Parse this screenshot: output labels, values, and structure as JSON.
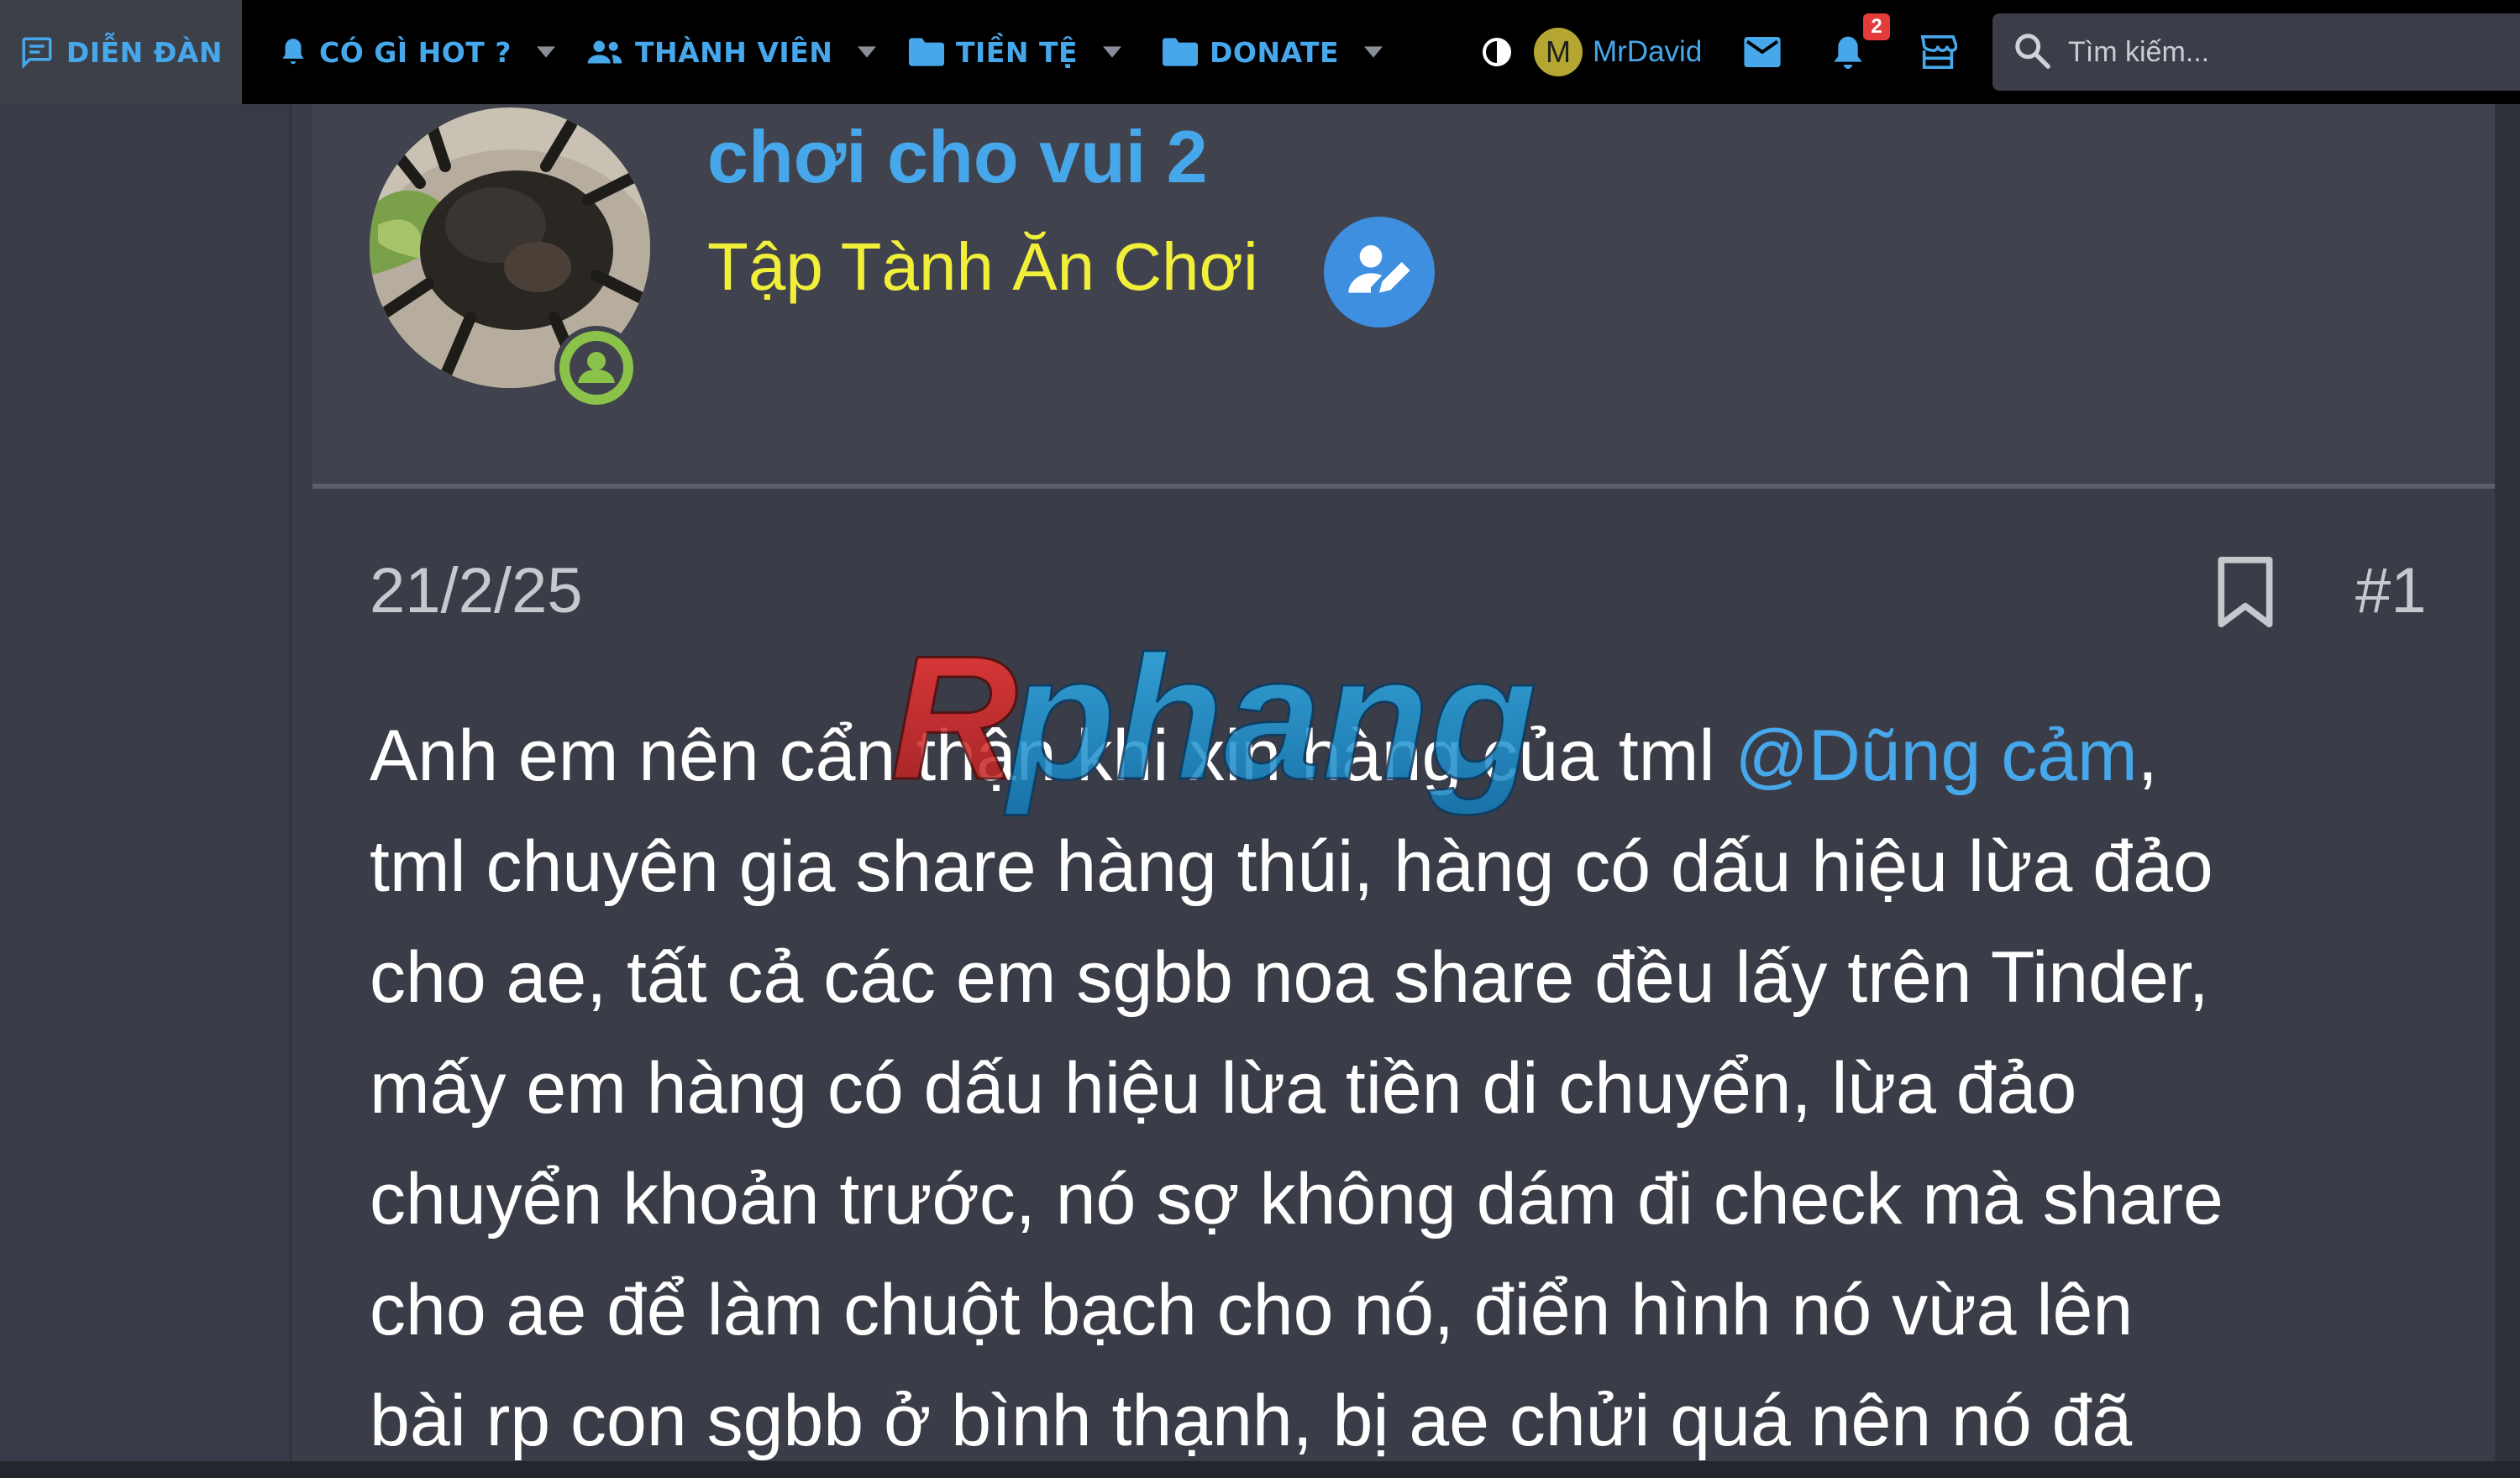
{
  "nav": {
    "items": [
      {
        "label": "DIỄN ĐÀN",
        "icon": "forum-icon",
        "active": true,
        "dropdown": false
      },
      {
        "label": "CÓ GÌ HOT ?",
        "icon": "bell-icon",
        "active": false,
        "dropdown": true
      },
      {
        "label": "THÀNH VIÊN",
        "icon": "members-icon",
        "active": false,
        "dropdown": true
      },
      {
        "label": "TIỀN TỆ",
        "icon": "folder-icon",
        "active": false,
        "dropdown": true
      },
      {
        "label": "DONATE",
        "icon": "folder-icon",
        "active": false,
        "dropdown": true
      }
    ],
    "user": {
      "initial": "M",
      "name": "MrDavid"
    },
    "notifications_count": "2",
    "search_placeholder": "Tìm kiếm..."
  },
  "thread_user": {
    "name": "chơi cho vui 2",
    "title": "Tập Tành Ăn Chơi"
  },
  "post": {
    "date": "21/2/25",
    "number": "#1",
    "mention": "@Dũng cảm",
    "lines": [
      {
        "before": "Anh em nên cẩn thận khi xin hàng của tml ",
        "after": ","
      },
      {
        "text": "tml chuyên gia share hàng thúi, hàng có dấu hiệu lừa đảo"
      },
      {
        "text": "cho ae, tất cả các em sgbb noa share đều lấy trên Tinder,"
      },
      {
        "text": "mấy em hàng có dấu hiệu lừa tiền di chuyển, lừa đảo"
      },
      {
        "text": "chuyển khoản trước, nó sợ không dám đi check mà share"
      },
      {
        "text": "cho ae để làm chuột bạch cho nó, điển hình nó vừa lên"
      },
      {
        "text": "bài rp con sgbb ở bình thạnh, bị ae chửi quá nên nó đã"
      }
    ]
  },
  "watermark": {
    "text": "Rphang"
  },
  "colors": {
    "accent": "#47a7eb",
    "title_yellow": "#f1ef3a",
    "online_green": "#8bc34a",
    "badge_red": "#e43b3b"
  }
}
